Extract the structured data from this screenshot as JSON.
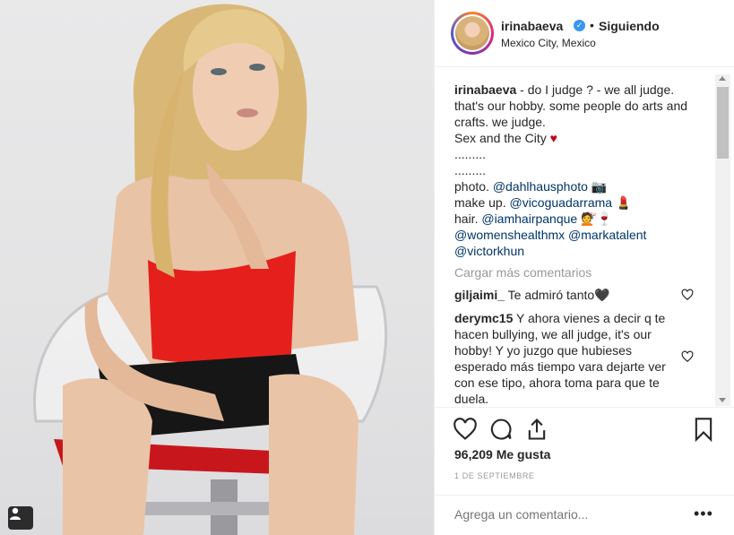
{
  "post": {
    "header": {
      "username": "irinabaeva",
      "verified_icon": "verified-badge-icon",
      "separator": "•",
      "follow_status": "Siguiendo",
      "location": "Mexico City, Mexico"
    },
    "caption": {
      "username": "irinabaeva",
      "lines": [
        " - do I judge ? - we all judge. that's our hobby. some people do arts and crafts. we judge.",
        "Sex and the City",
        ".........",
        ".........",
        "photo. ",
        "make up. ",
        "hair. "
      ],
      "heart_emoji": "♥",
      "photo_link": "@dahlhausphoto",
      "photo_emoji": "📷",
      "makeup_link": "@vicoguadarrama",
      "makeup_emoji": "💄",
      "hair_link": "@iamhairpanque",
      "hair_emoji": "💇🍷",
      "link_womenshealth": "@womenshealthmx",
      "link_markatalent": "@markatalent",
      "link_victorkhun": "@victorkhun"
    },
    "load_more": "Cargar más comentarios",
    "comments": [
      {
        "username": "giljaimi_",
        "text": " Te admiró tanto",
        "emoji": "🖤"
      },
      {
        "username": "derymc15",
        "text": " Y ahora vienes a decir q te hacen bullying, we all judge, it's our hobby! Y yo juzgo que hubieses esperado más tiempo vara dejarte ver con ese tipo, ahora toma para que te duela."
      }
    ],
    "likes": "96,209 Me gusta",
    "date": "1 DE SEPTIEMBRE",
    "add_comment_placeholder": "Agrega un comentario...",
    "options_label": "•••"
  },
  "colors": {
    "accent": "#3897f0",
    "link": "#003569",
    "muted": "#999999",
    "heart": "#c0001b"
  }
}
